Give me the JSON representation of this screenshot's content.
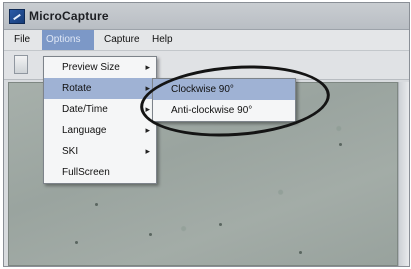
{
  "window": {
    "title": "MicroCapture"
  },
  "menubar": {
    "items": [
      {
        "label": "File"
      },
      {
        "label": "Options"
      },
      {
        "label": "Capture"
      },
      {
        "label": "Help"
      }
    ]
  },
  "options_menu": {
    "items": [
      {
        "label": "Preview Size",
        "submenu_arrow": "▸"
      },
      {
        "label": "Rotate",
        "submenu_arrow": "▸"
      },
      {
        "label": "Date/Time",
        "submenu_arrow": "▸"
      },
      {
        "label": "Language",
        "submenu_arrow": "▸"
      },
      {
        "label": "SKI",
        "submenu_arrow": "▸"
      },
      {
        "label": "FullScreen"
      }
    ]
  },
  "rotate_submenu": {
    "items": [
      {
        "label": "Clockwise 90°"
      },
      {
        "label": "Anti-clockwise 90°"
      }
    ]
  },
  "icons": {
    "app": "microscope-camera-icon",
    "toolbar_button": "capture-icon"
  },
  "colors": {
    "menu_highlight": "#9fb2d4",
    "open_menu": "#7c98c7",
    "callout_ring": "#141414"
  }
}
